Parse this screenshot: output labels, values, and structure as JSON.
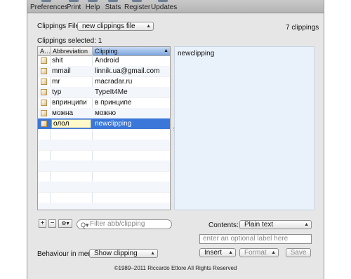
{
  "toolbar": {
    "items": [
      {
        "label": "Preferences"
      },
      {
        "label": "Print"
      },
      {
        "label": "Help"
      },
      {
        "label": "Stats"
      },
      {
        "label": "Register"
      },
      {
        "label": "Updates"
      }
    ]
  },
  "clippings_file": {
    "label": "Clippings File:",
    "selected": "new clippings file",
    "count": "7 clippings"
  },
  "selection": {
    "label": "Clippings selected: 1"
  },
  "table": {
    "headers": [
      "A…",
      "Abbreviation",
      "Clipping"
    ],
    "rows": [
      {
        "abbreviation": "shit",
        "clipping": "Android"
      },
      {
        "abbreviation": "mmail",
        "clipping": "linnik.ua@gmail.com"
      },
      {
        "abbreviation": "mr",
        "clipping": "macradar.ru"
      },
      {
        "abbreviation": "typ",
        "clipping": "TypeIt4Me"
      },
      {
        "abbreviation": "впринципи",
        "clipping": "в принципе"
      },
      {
        "abbreviation": "можна",
        "clipping": "можно"
      },
      {
        "abbreviation": "олол",
        "clipping": "newclipping",
        "selected": true
      }
    ]
  },
  "content_pane": {
    "text": "newclipping"
  },
  "bottom": {
    "add": "+",
    "remove": "−",
    "gear": "⚙▾",
    "search_placeholder": "Filter abb/clipping",
    "contents_label": "Contents:",
    "contents_value": "Plain text",
    "label_placeholder": "enter an optional label here",
    "insert": "Insert",
    "format": "Format",
    "save": "Save",
    "behaviour_label": "Behaviour in menu:",
    "behaviour_value": "Show clipping"
  },
  "copyright": "©1989–2011 Riccardo Ettore All Rights Reserved"
}
